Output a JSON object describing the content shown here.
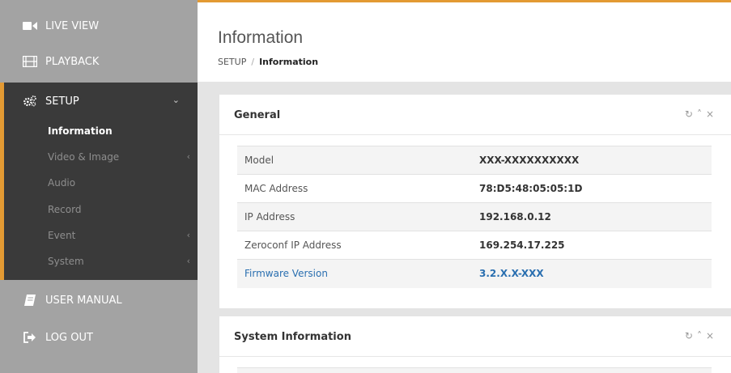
{
  "nav": {
    "live_view": "LIVE VIEW",
    "playback": "PLAYBACK",
    "setup": "SETUP",
    "user_manual": "USER MANUAL",
    "log_out": "LOG OUT"
  },
  "setup_menu": [
    {
      "label": "Information",
      "active": true,
      "has_arrow": false
    },
    {
      "label": "Video & Image",
      "active": false,
      "has_arrow": true
    },
    {
      "label": "Audio",
      "active": false,
      "has_arrow": false
    },
    {
      "label": "Record",
      "active": false,
      "has_arrow": false
    },
    {
      "label": "Event",
      "active": false,
      "has_arrow": true
    },
    {
      "label": "System",
      "active": false,
      "has_arrow": true
    }
  ],
  "header": {
    "title": "Information",
    "breadcrumb_root": "SETUP",
    "breadcrumb_sep": "/",
    "breadcrumb_current": "Information"
  },
  "general": {
    "title": "General",
    "rows": [
      {
        "label": "Model",
        "value": "XXX-XXXXXXXXXX"
      },
      {
        "label": "MAC Address",
        "value": "78:D5:48:05:05:1D"
      },
      {
        "label": "IP Address",
        "value": "192.168.0.12"
      },
      {
        "label": "Zeroconf IP Address",
        "value": "169.254.17.225"
      },
      {
        "label": "Firmware Version",
        "value": "3.2.X.X-XXX"
      }
    ]
  },
  "system_info": {
    "title": "System Information"
  },
  "icons": {
    "panel_tools": [
      "refresh-icon",
      "collapse-icon",
      "close-icon"
    ]
  },
  "colors": {
    "accent": "#e39a33",
    "sidebar_bg": "#a3a3a3",
    "setup_bg": "#3a3a3a",
    "link": "#2a6fb0"
  }
}
